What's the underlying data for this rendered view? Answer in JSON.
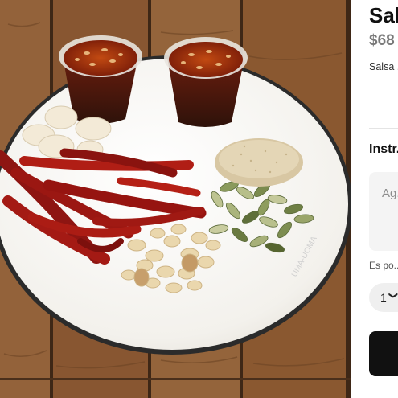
{
  "product": {
    "title": "Salsa",
    "price": "$68",
    "description": "Salsa ... pepita ... aceite ...",
    "image_alt": "Ingredientes: chiles secos, ajo, cacahuates, pepitas, ajonjolí y salsa macha"
  },
  "instructions": {
    "label": "Instr...",
    "placeholder": "Ag..."
  },
  "note": "Es po...",
  "quantity": {
    "value": "1",
    "chevron": "chevron-down-icon"
  },
  "cart": {
    "button_label": ""
  },
  "colors": {
    "title": "#111111",
    "price": "#7a7a7a",
    "field_bg": "#f4f4f4",
    "button": "#111111"
  }
}
